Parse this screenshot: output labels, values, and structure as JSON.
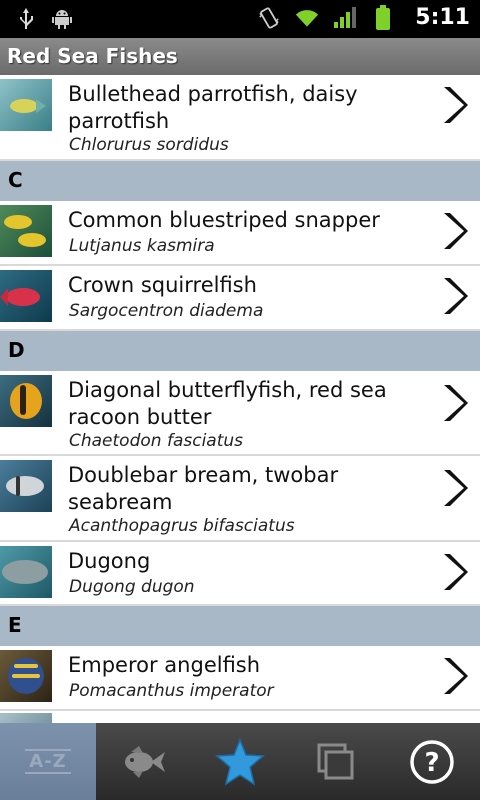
{
  "status_bar": {
    "time": "5:11",
    "left_icons": [
      "usb-icon",
      "android-debug-icon"
    ],
    "right_icons": [
      "vibrate-icon",
      "wifi-icon",
      "signal-icon",
      "battery-icon"
    ]
  },
  "title_bar": {
    "title": "Red Sea Fishes"
  },
  "list": {
    "rows": [
      {
        "type": "item",
        "name": "Bullethead parrotfish, daisy parrotfish",
        "scientific": "Chlorurus sordidus"
      },
      {
        "type": "header",
        "letter": "C"
      },
      {
        "type": "item",
        "name": "Common bluestriped snapper",
        "scientific": "Lutjanus kasmira"
      },
      {
        "type": "item",
        "name": "Crown squirrelfish",
        "scientific": "Sargocentron diadema"
      },
      {
        "type": "header",
        "letter": "D"
      },
      {
        "type": "item",
        "name": "Diagonal butterflyfish, red sea racoon butter",
        "scientific": "Chaetodon fasciatus"
      },
      {
        "type": "item",
        "name": "Doublebar bream, twobar seabream",
        "scientific": "Acanthopagrus bifasciatus"
      },
      {
        "type": "item",
        "name": "Dugong",
        "scientific": "Dugong dugon"
      },
      {
        "type": "header",
        "letter": "E"
      },
      {
        "type": "item",
        "name": "Emperor angelfish",
        "scientific": "Pomacanthus imperator"
      }
    ]
  },
  "bottom_bar": {
    "tabs": [
      {
        "name": "tab-az",
        "label": "A-Z",
        "icon": "az-icon",
        "active": true
      },
      {
        "name": "tab-fish",
        "icon": "fish-icon",
        "active": false
      },
      {
        "name": "tab-favorites",
        "icon": "star-icon",
        "active": false
      },
      {
        "name": "tab-gallery",
        "icon": "gallery-icon",
        "active": false
      },
      {
        "name": "tab-help",
        "icon": "help-icon",
        "active": false
      }
    ]
  },
  "colors": {
    "title_bar": "#777777",
    "section_header": "#a9b8c7",
    "active_tab": "#7289a3",
    "star": "#3399dd"
  }
}
